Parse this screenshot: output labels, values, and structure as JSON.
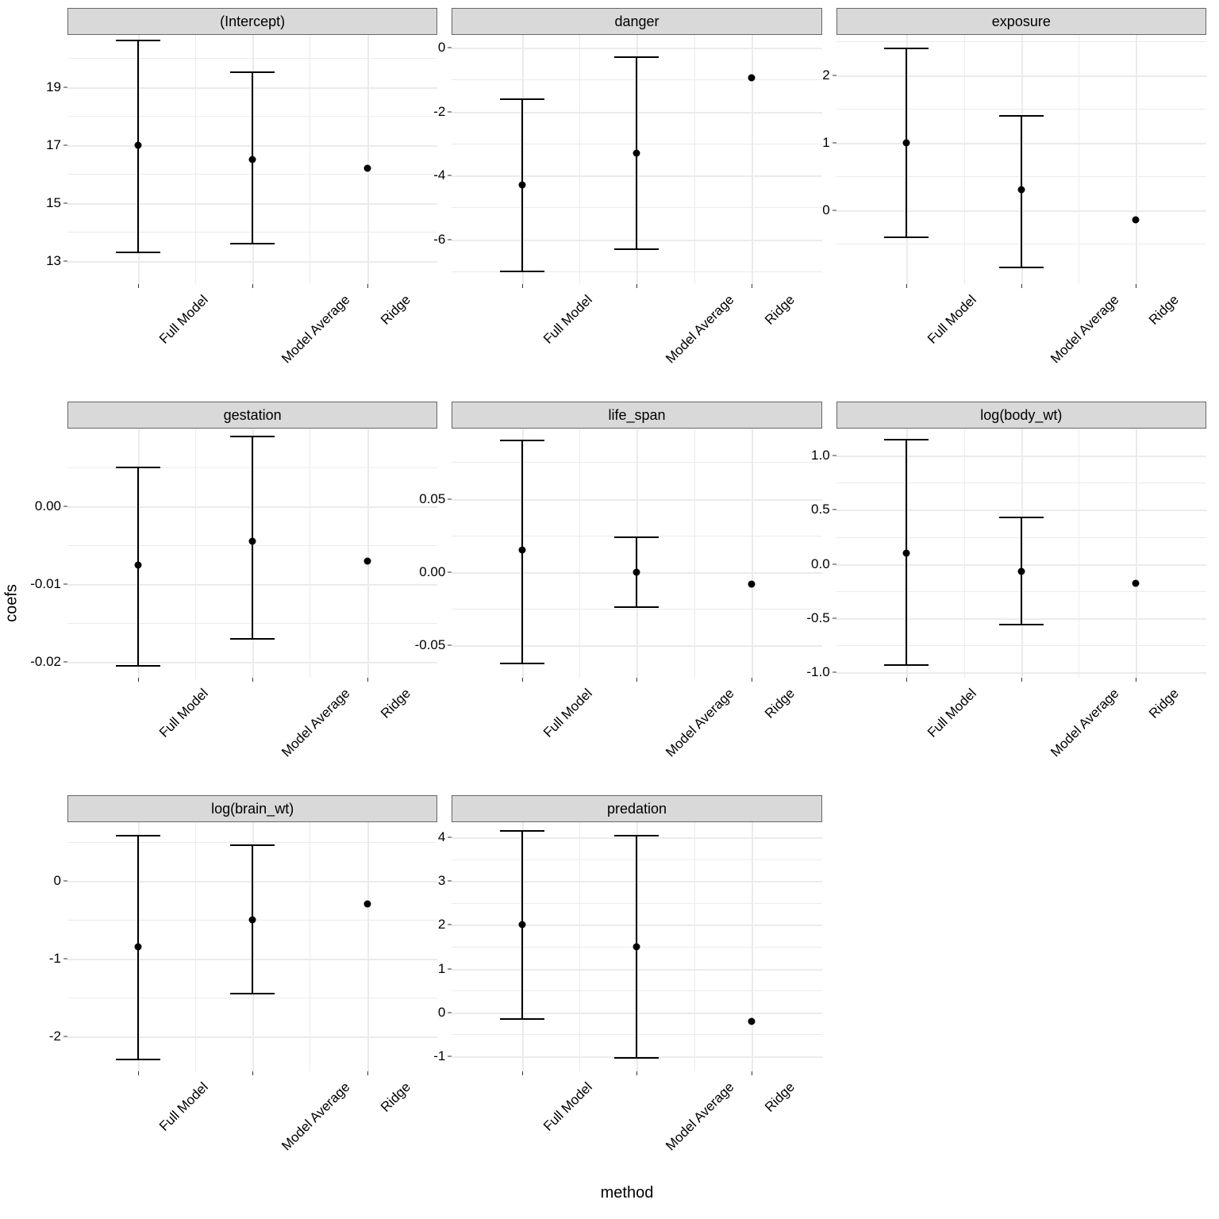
{
  "axis_titles": {
    "x": "method",
    "y": "coefs"
  },
  "categories": [
    "Full Model",
    "Model Average",
    "Ridge"
  ],
  "chart_data": [
    {
      "title": "(Intercept)",
      "type": "pointrange",
      "y_range": [
        12.2,
        20.8
      ],
      "y_ticks": [
        13,
        15,
        17,
        19
      ],
      "series": [
        {
          "x": "Full Model",
          "y": 17.0,
          "lo": 13.3,
          "hi": 20.6
        },
        {
          "x": "Model Average",
          "y": 16.5,
          "lo": 13.6,
          "hi": 19.5
        },
        {
          "x": "Ridge",
          "y": 16.2,
          "lo": null,
          "hi": null
        }
      ]
    },
    {
      "title": "danger",
      "type": "pointrange",
      "y_range": [
        -7.4,
        0.4
      ],
      "y_ticks": [
        -6,
        -4,
        -2,
        0
      ],
      "series": [
        {
          "x": "Full Model",
          "y": -4.3,
          "lo": -7.0,
          "hi": -1.6
        },
        {
          "x": "Model Average",
          "y": -3.3,
          "lo": -6.3,
          "hi": -0.3
        },
        {
          "x": "Ridge",
          "y": -0.95,
          "lo": null,
          "hi": null
        }
      ]
    },
    {
      "title": "exposure",
      "type": "pointrange",
      "y_range": [
        -1.1,
        2.6
      ],
      "y_ticks": [
        0,
        1,
        2
      ],
      "series": [
        {
          "x": "Full Model",
          "y": 1.0,
          "lo": -0.4,
          "hi": 2.4
        },
        {
          "x": "Model Average",
          "y": 0.3,
          "lo": -0.85,
          "hi": 1.4
        },
        {
          "x": "Ridge",
          "y": -0.15,
          "lo": null,
          "hi": null
        }
      ]
    },
    {
      "title": "gestation",
      "type": "pointrange",
      "y_range": [
        -0.022,
        0.01
      ],
      "y_ticks": [
        -0.02,
        -0.01,
        0.0
      ],
      "y_tick_labels": [
        "-0.02",
        "-0.01",
        "0.00"
      ],
      "series": [
        {
          "x": "Full Model",
          "y": -0.0075,
          "lo": -0.0205,
          "hi": 0.005
        },
        {
          "x": "Model Average",
          "y": -0.0045,
          "lo": -0.017,
          "hi": 0.009
        },
        {
          "x": "Ridge",
          "y": -0.007,
          "lo": null,
          "hi": null
        }
      ]
    },
    {
      "title": "life_span",
      "type": "pointrange",
      "y_range": [
        -0.072,
        0.098
      ],
      "y_ticks": [
        -0.05,
        0.0,
        0.05
      ],
      "y_tick_labels": [
        "-0.05",
        "0.00",
        "0.05"
      ],
      "series": [
        {
          "x": "Full Model",
          "y": 0.015,
          "lo": -0.062,
          "hi": 0.09
        },
        {
          "x": "Model Average",
          "y": 0.0,
          "lo": -0.024,
          "hi": 0.024
        },
        {
          "x": "Ridge",
          "y": -0.008,
          "lo": null,
          "hi": null
        }
      ]
    },
    {
      "title": "log(body_wt)",
      "type": "pointrange",
      "y_range": [
        -1.05,
        1.25
      ],
      "y_ticks": [
        -1.0,
        -0.5,
        0.0,
        0.5,
        1.0
      ],
      "y_tick_labels": [
        "-1.0",
        "-0.5",
        "0.0",
        "0.5",
        "1.0"
      ],
      "series": [
        {
          "x": "Full Model",
          "y": 0.1,
          "lo": -0.93,
          "hi": 1.15
        },
        {
          "x": "Model Average",
          "y": -0.07,
          "lo": -0.56,
          "hi": 0.43
        },
        {
          "x": "Ridge",
          "y": -0.18,
          "lo": null,
          "hi": null
        }
      ]
    },
    {
      "title": "log(brain_wt)",
      "type": "pointrange",
      "y_range": [
        -2.45,
        0.75
      ],
      "y_ticks": [
        -2,
        -1,
        0
      ],
      "series": [
        {
          "x": "Full Model",
          "y": -0.85,
          "lo": -2.3,
          "hi": 0.58
        },
        {
          "x": "Model Average",
          "y": -0.5,
          "lo": -1.45,
          "hi": 0.45
        },
        {
          "x": "Ridge",
          "y": -0.3,
          "lo": null,
          "hi": null
        }
      ]
    },
    {
      "title": "predation",
      "type": "pointrange",
      "y_range": [
        -1.35,
        4.35
      ],
      "y_ticks": [
        -1,
        0,
        1,
        2,
        3,
        4
      ],
      "series": [
        {
          "x": "Full Model",
          "y": 2.0,
          "lo": -0.15,
          "hi": 4.15
        },
        {
          "x": "Model Average",
          "y": 1.5,
          "lo": -1.05,
          "hi": 4.05
        },
        {
          "x": "Ridge",
          "y": -0.2,
          "lo": null,
          "hi": null
        }
      ]
    }
  ]
}
